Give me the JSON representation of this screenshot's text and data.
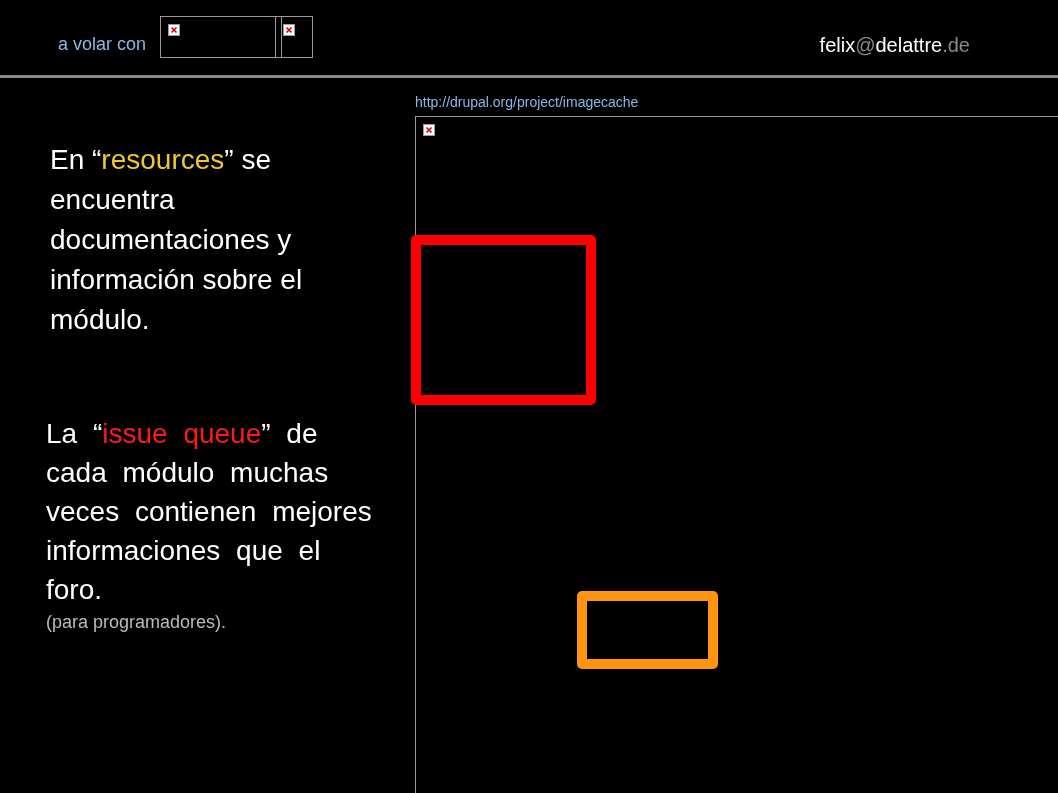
{
  "header": {
    "tagline": "a volar con",
    "logos": [
      {
        "kind": "broken-image"
      },
      {
        "kind": "broken-image"
      }
    ],
    "email": [
      {
        "text": "felix",
        "muted": false
      },
      {
        "text": "@",
        "muted": true
      },
      {
        "text": "delattre",
        "muted": false
      },
      {
        "text": ".de",
        "muted": true
      }
    ]
  },
  "paragraphs": [
    {
      "segments": [
        {
          "text": "En “"
        },
        {
          "text": "resources",
          "color": "#f0c830"
        },
        {
          "text": "” se encuentra documentaciones y información sobre el módulo."
        }
      ]
    },
    {
      "segments": [
        {
          "text": "La “"
        },
        {
          "text": "issue queue",
          "color": "#ff1a1a"
        },
        {
          "text": "” de cada módulo muchas veces contienen mejores informaciones que el foro."
        }
      ],
      "note": "(para programadores)."
    }
  ],
  "screenshot": {
    "url": "http://drupal.org/project/imagecache",
    "highlights": [
      {
        "color": "#ff0000"
      },
      {
        "color": "#ff9410"
      }
    ]
  }
}
